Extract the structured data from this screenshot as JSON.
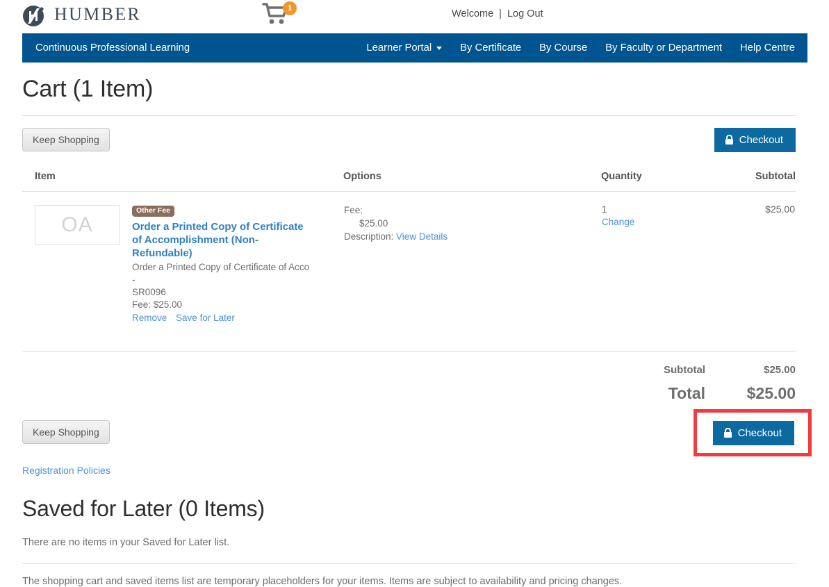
{
  "header": {
    "logo_text": "HUMBER",
    "logo_icon": "humber-h-circle-logo",
    "cart_icon": "shopping-cart-icon",
    "cart_badge_count": "1",
    "welcome_label": "Welcome",
    "separator": "|",
    "logout_label": "Log Out"
  },
  "nav": {
    "brand": "Continuous Professional Learning",
    "items": [
      {
        "label": "Learner Portal",
        "has_caret": true
      },
      {
        "label": "By Certificate",
        "has_caret": false
      },
      {
        "label": "By Course",
        "has_caret": false
      },
      {
        "label": "By Faculty or Department",
        "has_caret": false
      },
      {
        "label": "Help Centre",
        "has_caret": false
      }
    ]
  },
  "page": {
    "title": "Cart (1 Item)"
  },
  "actions": {
    "keep_shopping_label": "Keep Shopping",
    "checkout_label": "Checkout",
    "lock_icon": "lock-icon"
  },
  "table": {
    "headers": {
      "item": "Item",
      "options": "Options",
      "quantity": "Quantity",
      "subtotal": "Subtotal"
    },
    "rows": [
      {
        "thumb_text": "OA",
        "tag": "Other Fee",
        "title": "Order a Printed Copy of Certificate of Accomplishment (Non-Refundable)",
        "sub_line_1": "Order a Printed Copy of Certificate of Acco -",
        "sub_line_2": "SR0096",
        "fee_line": "Fee: $25.00",
        "remove_label": "Remove",
        "save_for_later_label": "Save for Later",
        "options_fee_label": "Fee:",
        "options_fee_value": "$25.00",
        "options_description_label": "Description:",
        "options_view_details_label": "View Details",
        "quantity": "1",
        "change_label": "Change",
        "subtotal": "$25.00"
      }
    ]
  },
  "totals": {
    "subtotal_label": "Subtotal",
    "subtotal_value": "$25.00",
    "total_label": "Total",
    "total_value": "$25.00"
  },
  "footer": {
    "registration_policies_label": "Registration Policies",
    "saved_title": "Saved for Later (0 Items)",
    "saved_empty_text": "There are no items in your Saved for Later list.",
    "note": "The shopping cart and saved items list are temporary placeholders for your items. Items are subject to availability and pricing changes."
  },
  "colors": {
    "nav_blue": "#00548f",
    "button_blue": "#0d6aa0",
    "link_blue": "#4a90d9",
    "badge_orange": "#f0962b",
    "tag_brown": "#8a6d5a",
    "highlight_red": "#f03c3c"
  }
}
